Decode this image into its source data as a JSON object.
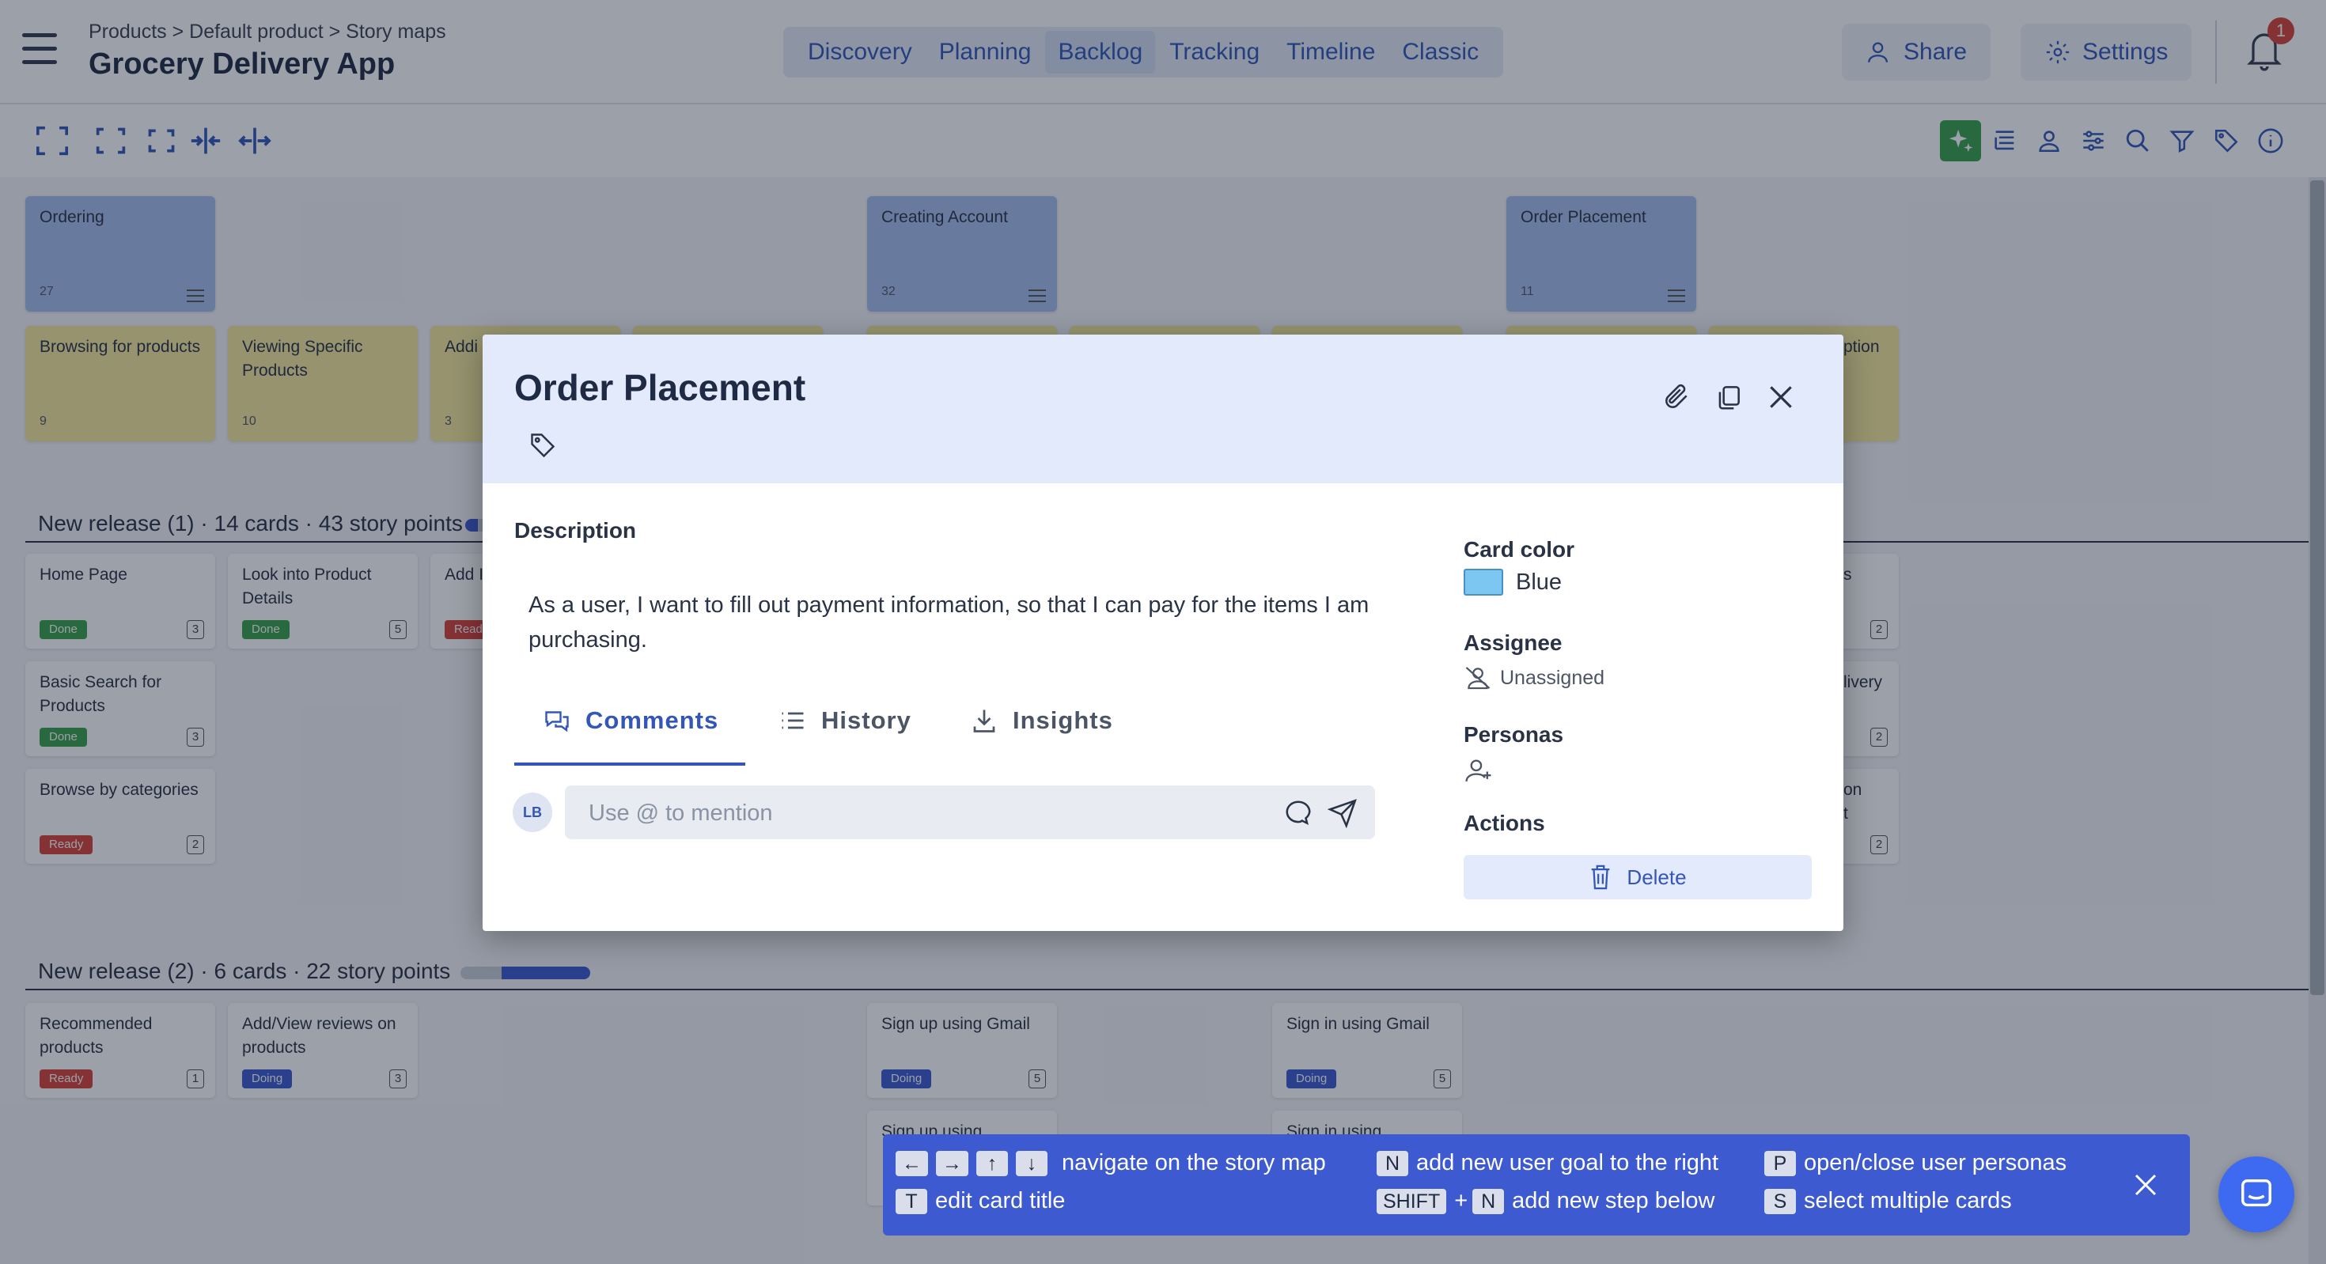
{
  "header": {
    "breadcrumb": "Products > Default product > Story maps",
    "app_title": "Grocery Delivery App",
    "nav_tabs": [
      "Discovery",
      "Planning",
      "Backlog",
      "Tracking",
      "Timeline",
      "Classic"
    ],
    "active_tab": "Backlog",
    "share_label": "Share",
    "settings_label": "Settings",
    "notification_count": "1"
  },
  "goals": [
    {
      "title": "Ordering",
      "count": "27"
    },
    {
      "title": "Creating Account",
      "count": "32"
    },
    {
      "title": "Order Placement",
      "count": "11"
    }
  ],
  "steps": [
    {
      "title": "Browsing for products",
      "count": "9"
    },
    {
      "title": "Viewing Specific Products",
      "count": "10"
    },
    {
      "title": "Addi",
      "count": "3"
    },
    {
      "title": "ption",
      "count": ""
    }
  ],
  "releases": [
    {
      "label": "New release (1) · 14 cards · 43 story points",
      "progress": 0.1
    },
    {
      "label": "New release (2) · 6 cards · 22 story points",
      "progress": 0.68
    }
  ],
  "release1_cards": [
    {
      "title": "Home Page",
      "status": "Done",
      "points": "3"
    },
    {
      "title": "Look into Product Details",
      "status": "Done",
      "points": "5"
    },
    {
      "title": "Add I",
      "status": "Read",
      "points": ""
    },
    {
      "title": "Basic Search for Products",
      "status": "Done",
      "points": "3"
    },
    {
      "title": "Browse by categories",
      "status": "Ready",
      "points": "2"
    },
    {
      "title": "s",
      "status": "",
      "points": "2"
    },
    {
      "title": "livery",
      "status": "",
      "points": "2"
    },
    {
      "title": "on\nt",
      "status": "",
      "points": "2"
    }
  ],
  "release2_cards": [
    {
      "title": "Recommended products",
      "status": "Ready",
      "points": "1"
    },
    {
      "title": "Add/View reviews on products",
      "status": "Doing",
      "points": "3"
    },
    {
      "title": "Sign up using Gmail",
      "status": "Doing",
      "points": "5"
    },
    {
      "title": "Sign in using Gmail",
      "status": "Doing",
      "points": "5"
    },
    {
      "title": "Sign up using",
      "status": "",
      "points": ""
    },
    {
      "title": "Sign in using",
      "status": "",
      "points": ""
    }
  ],
  "modal": {
    "title": "Order Placement",
    "description_heading": "Description",
    "description": "As a user, I want to fill out payment information, so that I can pay for the items I am purchasing.",
    "tabs": [
      "Comments",
      "History",
      "Insights"
    ],
    "active_tab": "Comments",
    "avatar_initials": "LB",
    "comment_placeholder": "Use @ to mention",
    "card_color_heading": "Card color",
    "card_color_value": "Blue",
    "card_color_hex": "#7cc6f2",
    "assignee_heading": "Assignee",
    "assignee_value": "Unassigned",
    "personas_heading": "Personas",
    "actions_heading": "Actions",
    "delete_label": "Delete"
  },
  "shortcuts": {
    "navigate_text": "navigate on the story map",
    "edit_key": "T",
    "edit_text": "edit card title",
    "goal_key": "N",
    "goal_text": "add new user goal to the right",
    "shift_key": "SHIFT",
    "plus": "+",
    "step_key": "N",
    "step_text": "add new step below",
    "personas_key": "P",
    "personas_text": "open/close user personas",
    "select_key": "S",
    "select_text": "select multiple cards"
  },
  "colors": {
    "accent": "#3356b8",
    "goal_card": "#a6bff0",
    "step_card": "#f5e89c",
    "done": "#3aa14a",
    "ready": "#d8423a",
    "doing": "#3d5ad0"
  }
}
